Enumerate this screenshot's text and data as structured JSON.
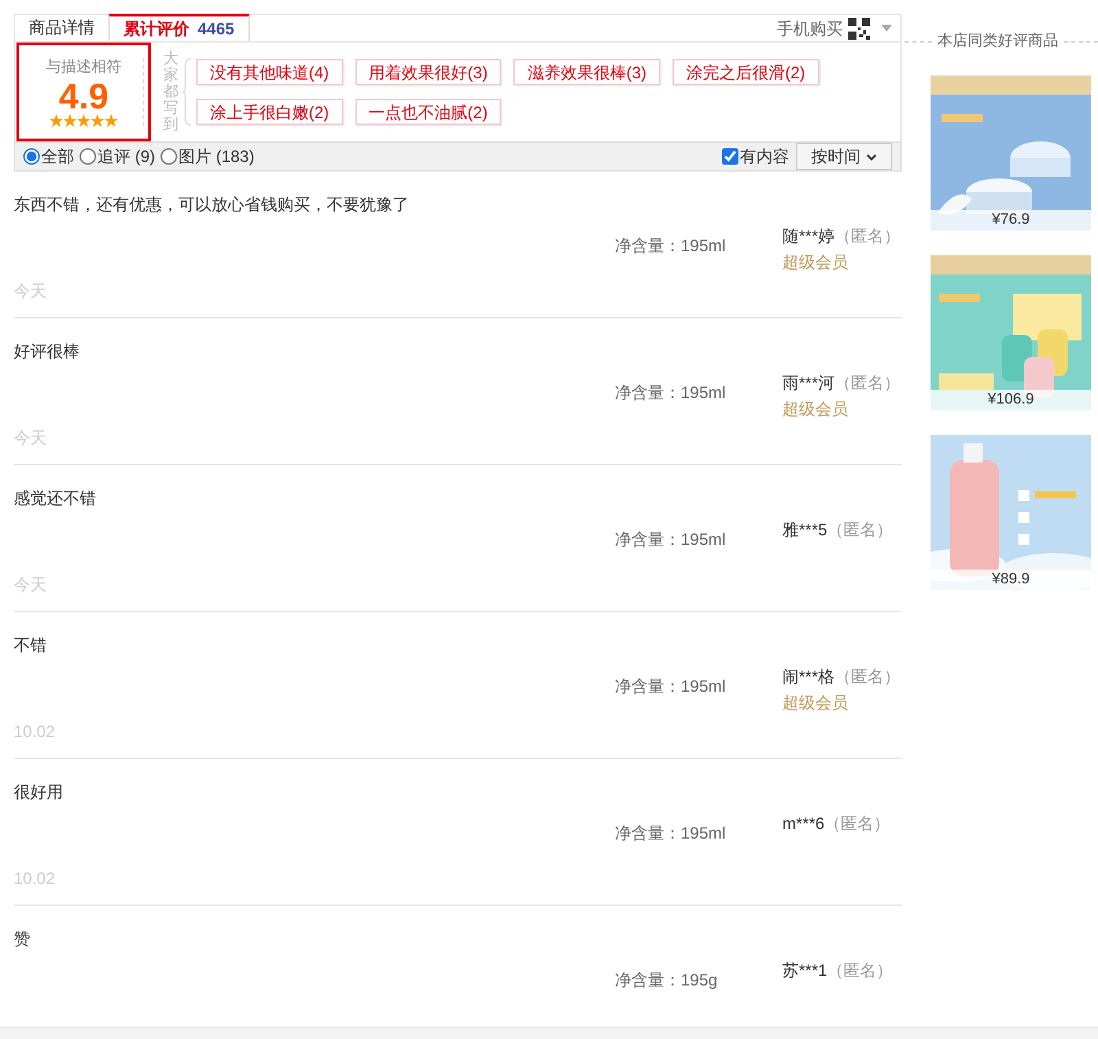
{
  "tabs": [
    {
      "label": "商品详情",
      "selected": false
    },
    {
      "label": "累计评价",
      "count": "4465",
      "selected": true
    }
  ],
  "mobile_buy": "手机购买",
  "side_title": "本店同类好评商品",
  "rating": {
    "label": "与描述相符",
    "score": "4.9",
    "stars": 5
  },
  "tags_label": "大家都写到",
  "tags": [
    "没有其他味道(4)",
    "用着效果很好(3)",
    "滋养效果很棒(3)",
    "涂完之后很滑(2)",
    "涂上手很白嫩(2)",
    "一点也不油腻(2)"
  ],
  "filters": [
    {
      "label": "全部",
      "selected": true
    },
    {
      "label": "追评 (9)",
      "selected": false
    },
    {
      "label": "图片 (183)",
      "selected": false
    }
  ],
  "content_only": {
    "label": "有内容",
    "checked": true
  },
  "sort": {
    "value": "按时间"
  },
  "reviews": [
    {
      "text": "东西不错，还有优惠，可以放心省钱购买，不要犹豫了",
      "spec": "净含量：195ml",
      "user": "随***婷",
      "anonymous": "（匿名）",
      "member": "超级会员",
      "date": "今天"
    },
    {
      "text": "好评很棒",
      "spec": "净含量：195ml",
      "user": "雨***河",
      "anonymous": "（匿名）",
      "member": "超级会员",
      "date": "今天"
    },
    {
      "text": "感觉还不错",
      "spec": "净含量：195ml",
      "user": "雅***5",
      "anonymous": "（匿名）",
      "date": "今天"
    },
    {
      "text": "不错",
      "spec": "净含量：195ml",
      "user": "闹***格",
      "anonymous": "（匿名）",
      "member": "超级会员",
      "date": "10.02"
    },
    {
      "text": "很好用",
      "spec": "净含量：195ml",
      "user": "m***6",
      "anonymous": "（匿名）",
      "date": "10.02"
    },
    {
      "text": "赞",
      "spec": "净含量：195g",
      "user": "苏***1",
      "anonymous": "（匿名）"
    }
  ],
  "recommended": [
    {
      "kind": "picture",
      "price": "¥76.9"
    },
    {
      "kind": "picture",
      "price": "¥106.9"
    },
    {
      "kind": "picture",
      "price": "¥89.9"
    }
  ]
}
